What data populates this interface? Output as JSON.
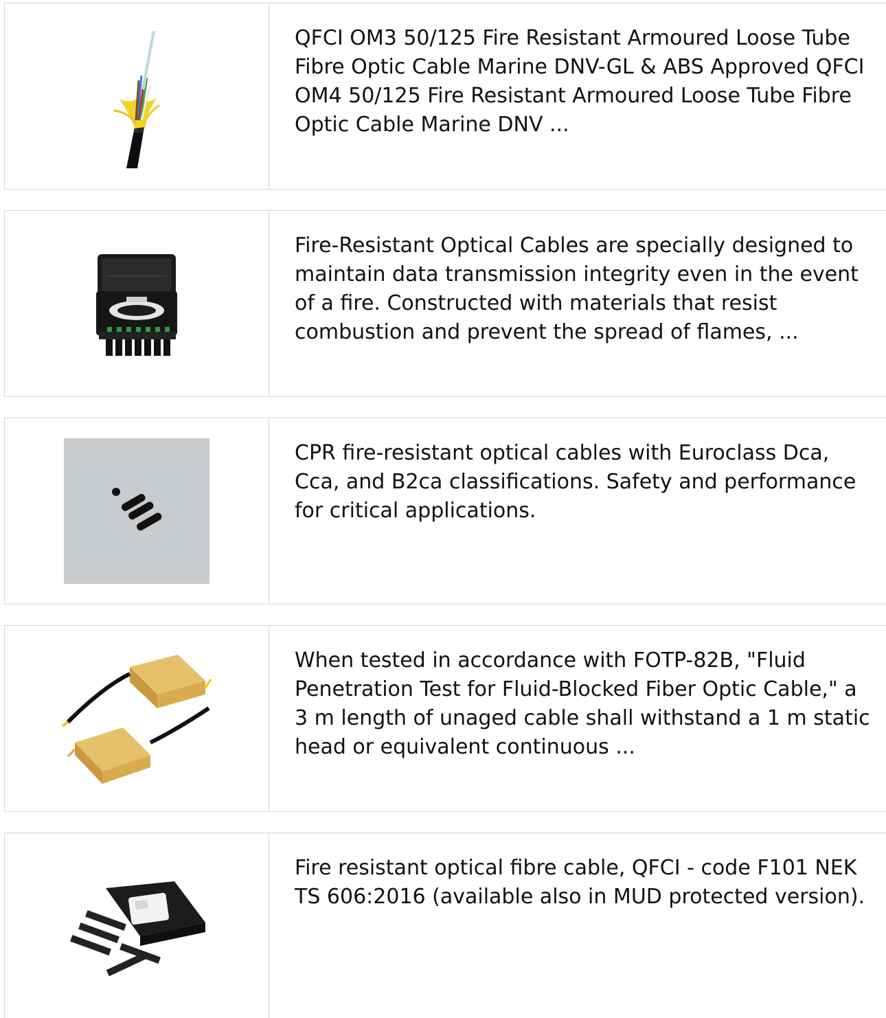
{
  "products": [
    {
      "image_icon": "armoured-fibre-cable-image",
      "description": "QFCI OM3 50/125 Fire Resistant Armoured Loose Tube Fibre Optic Cable Marine DNV-GL & ABS Approved QFCI OM4 50/125 Fire Resistant Armoured Loose Tube Fibre Optic Cable Marine DNV ..."
    },
    {
      "image_icon": "fibre-splice-closure-image",
      "description": "Fire-Resistant Optical Cables are specially designed to maintain data transmission integrity even in the event of a fire. Constructed with materials that resist combustion and prevent the spread of flames, ..."
    },
    {
      "image_icon": "connector-parts-image",
      "description": "CPR fire-resistant optical cables with Euroclass Dca, Cca, and B2ca classifications. Safety and performance for critical applications."
    },
    {
      "image_icon": "gold-laser-modules-image",
      "description": "When tested in accordance with FOTP-82B, \"Fluid Penetration Test for Fluid-Blocked Fiber Optic Cable,\" a 3 m length of unaged cable shall withstand a 1 m static head or equivalent continuous ..."
    },
    {
      "image_icon": "splice-closure-kit-image",
      "description": "Fire resistant optical fibre cable, QFCI - code F101 NEK TS 606:2016 (available also in MUD protected version)."
    }
  ]
}
